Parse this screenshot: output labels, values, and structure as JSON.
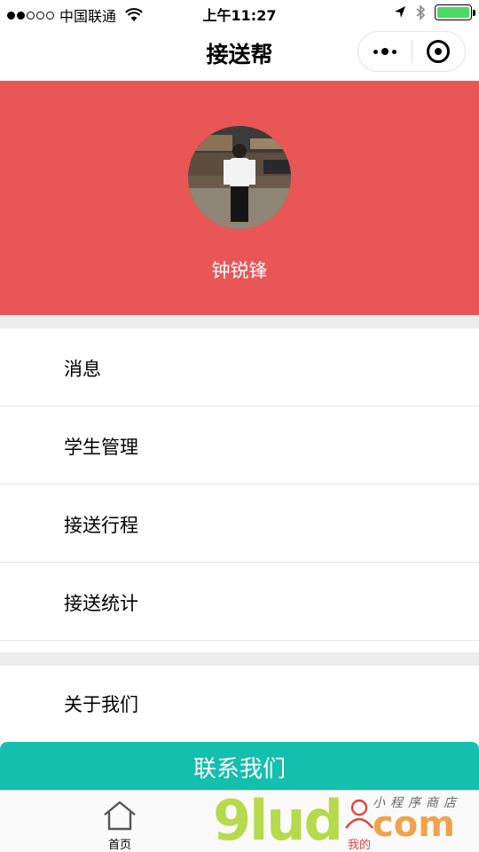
{
  "status_bar": {
    "carrier": "中国联通",
    "time": "上午11:27"
  },
  "nav": {
    "title": "接送帮"
  },
  "profile": {
    "name": "钟锐锋",
    "header_color": "#e85656"
  },
  "menu": {
    "group1": [
      "消息",
      "学生管理",
      "接送行程",
      "接送统计"
    ],
    "group2": [
      "关于我们"
    ]
  },
  "contact_button": "联系我们",
  "tab_bar": {
    "home": "首页",
    "mine": "我的",
    "active_color": "#e64340"
  },
  "watermark": {
    "brand": "9lud",
    "suffix": "com",
    "subtitle": "小程序商店"
  },
  "colors": {
    "accent_teal": "#14bfae",
    "battery_green": "#4cd964"
  }
}
